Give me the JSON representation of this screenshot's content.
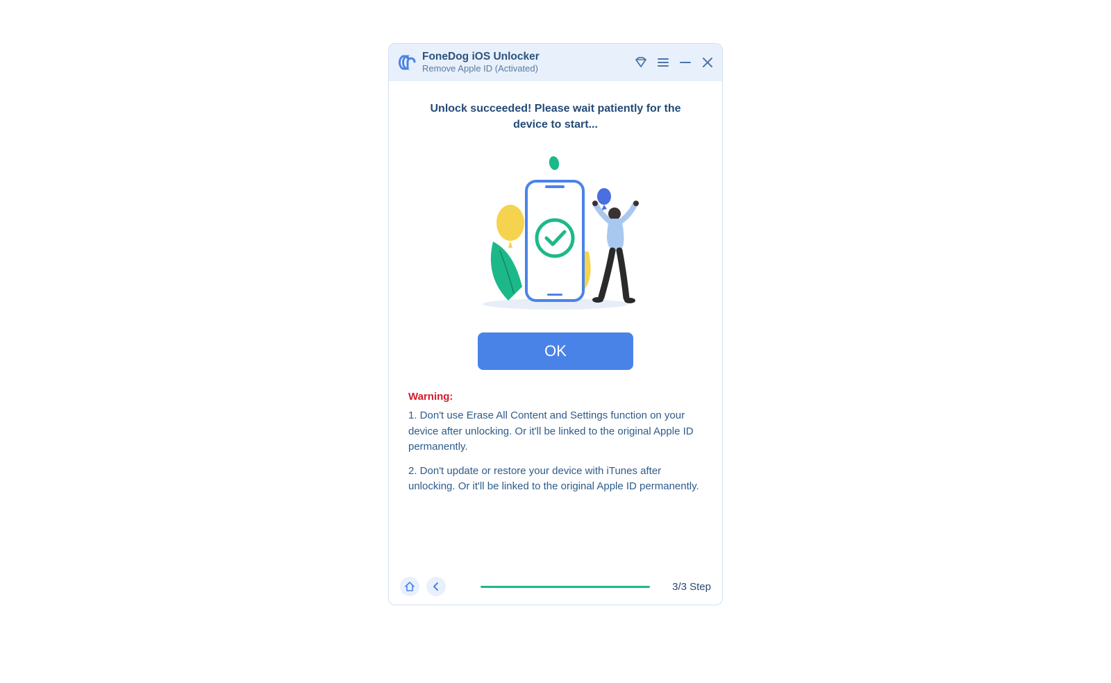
{
  "header": {
    "app_title": "FoneDog iOS Unlocker",
    "subtitle": "Remove Apple ID  (Activated)",
    "icons": {
      "logo": "fonedog-logo",
      "diamond": "diamond-icon",
      "menu": "menu-icon",
      "minimize": "minimize-icon",
      "close": "close-icon"
    }
  },
  "main": {
    "headline": "Unlock succeeded! Please wait patiently for the device to start...",
    "ok_label": "OK"
  },
  "warning": {
    "title": "Warning:",
    "item1": "1. Don't use Erase All Content and Settings function on your device after unlocking. Or it'll be linked to the original Apple ID permanently.",
    "item2": "2. Don't update or restore your device with iTunes after unlocking. Or it'll be linked to the original Apple ID permanently."
  },
  "footer": {
    "step_label": "3/3 Step",
    "progress_percent": 100
  }
}
